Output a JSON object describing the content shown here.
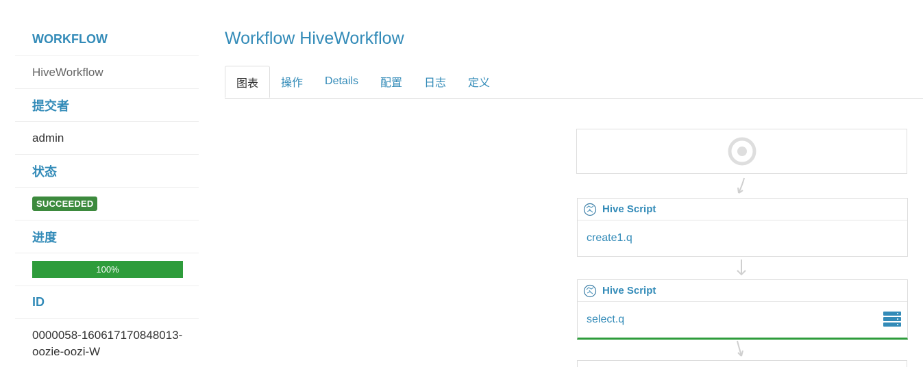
{
  "sidebar": {
    "workflow_label": "WORKFLOW",
    "workflow_name": "HiveWorkflow",
    "submitter_label": "提交者",
    "submitter": "admin",
    "status_label": "状态",
    "status": "SUCCEEDED",
    "progress_label": "进度",
    "progress_text": "100%",
    "progress_value": 100,
    "id_label": "ID",
    "id_line1": "0000058-160617170848013-",
    "id_line2": "oozie-oozi-W"
  },
  "main": {
    "title": "Workflow HiveWorkflow",
    "tabs": [
      {
        "label": "图表",
        "active": true
      },
      {
        "label": "操作"
      },
      {
        "label": "Details"
      },
      {
        "label": "配置"
      },
      {
        "label": "日志"
      },
      {
        "label": "定义"
      }
    ]
  },
  "graph": {
    "nodes": [
      {
        "type": "Hive Script",
        "name": "create1.q"
      },
      {
        "type": "Hive Script",
        "name": "select.q"
      }
    ]
  },
  "colors": {
    "accent": "#338bb8",
    "success": "#3c8a3d",
    "progress": "#2e9c3b"
  }
}
